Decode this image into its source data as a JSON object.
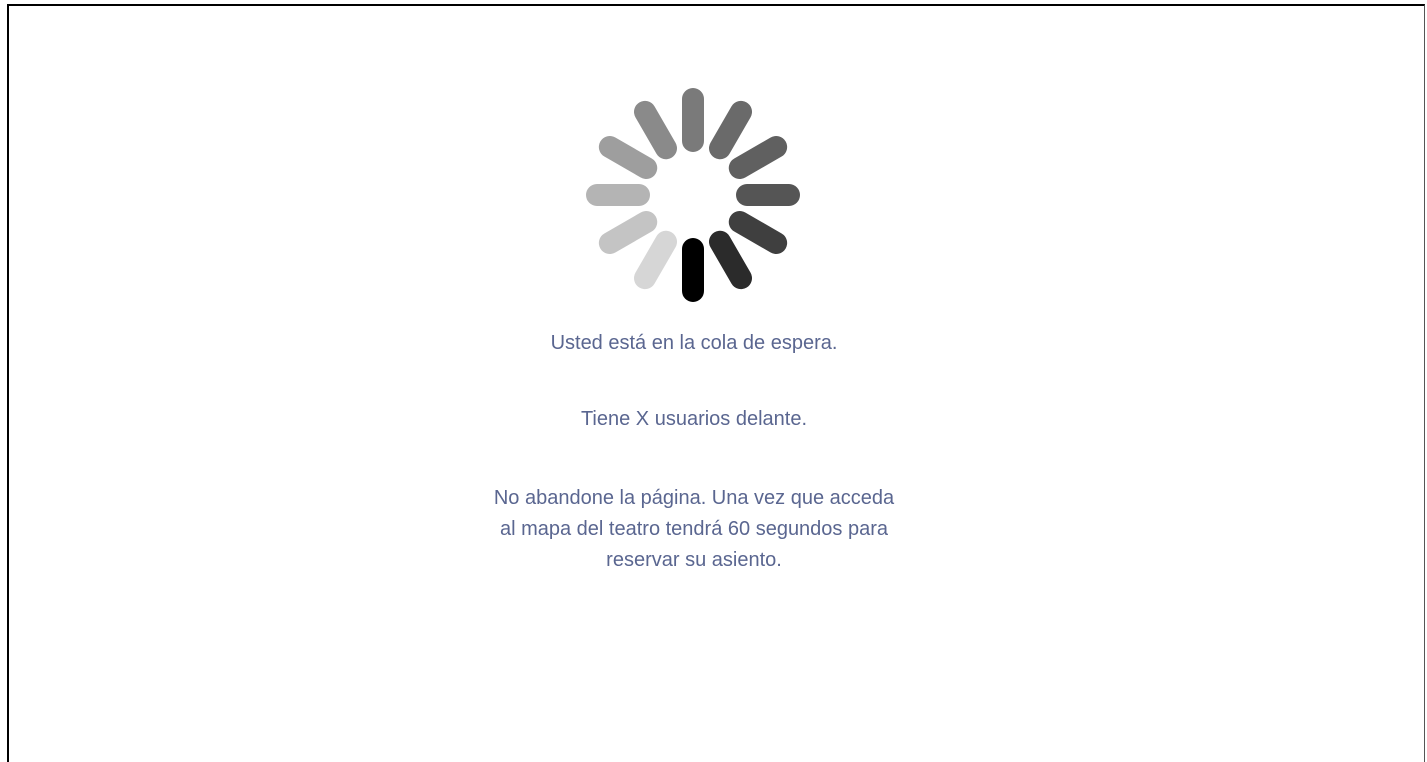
{
  "spinner": {
    "icon": "loading-spinner-icon",
    "spoke_colors": [
      "#000000",
      "#2b2b2b",
      "#3f3f3f",
      "#555555",
      "#606060",
      "#6a6a6a",
      "#7a7a7a",
      "#8a8a8a",
      "#9e9e9e",
      "#b4b4b4",
      "#c4c4c4",
      "#d6d6d6"
    ]
  },
  "queue": {
    "status_text": "Usted está en la cola de espera.",
    "users_ahead_text": "Tiene X usuarios delante.",
    "notice_text": "No abandone la página. Una vez que acceda al mapa del teatro tendrá 60 segundos para reservar su asiento."
  },
  "colors": {
    "text": "#5a6690",
    "background": "#ffffff"
  }
}
